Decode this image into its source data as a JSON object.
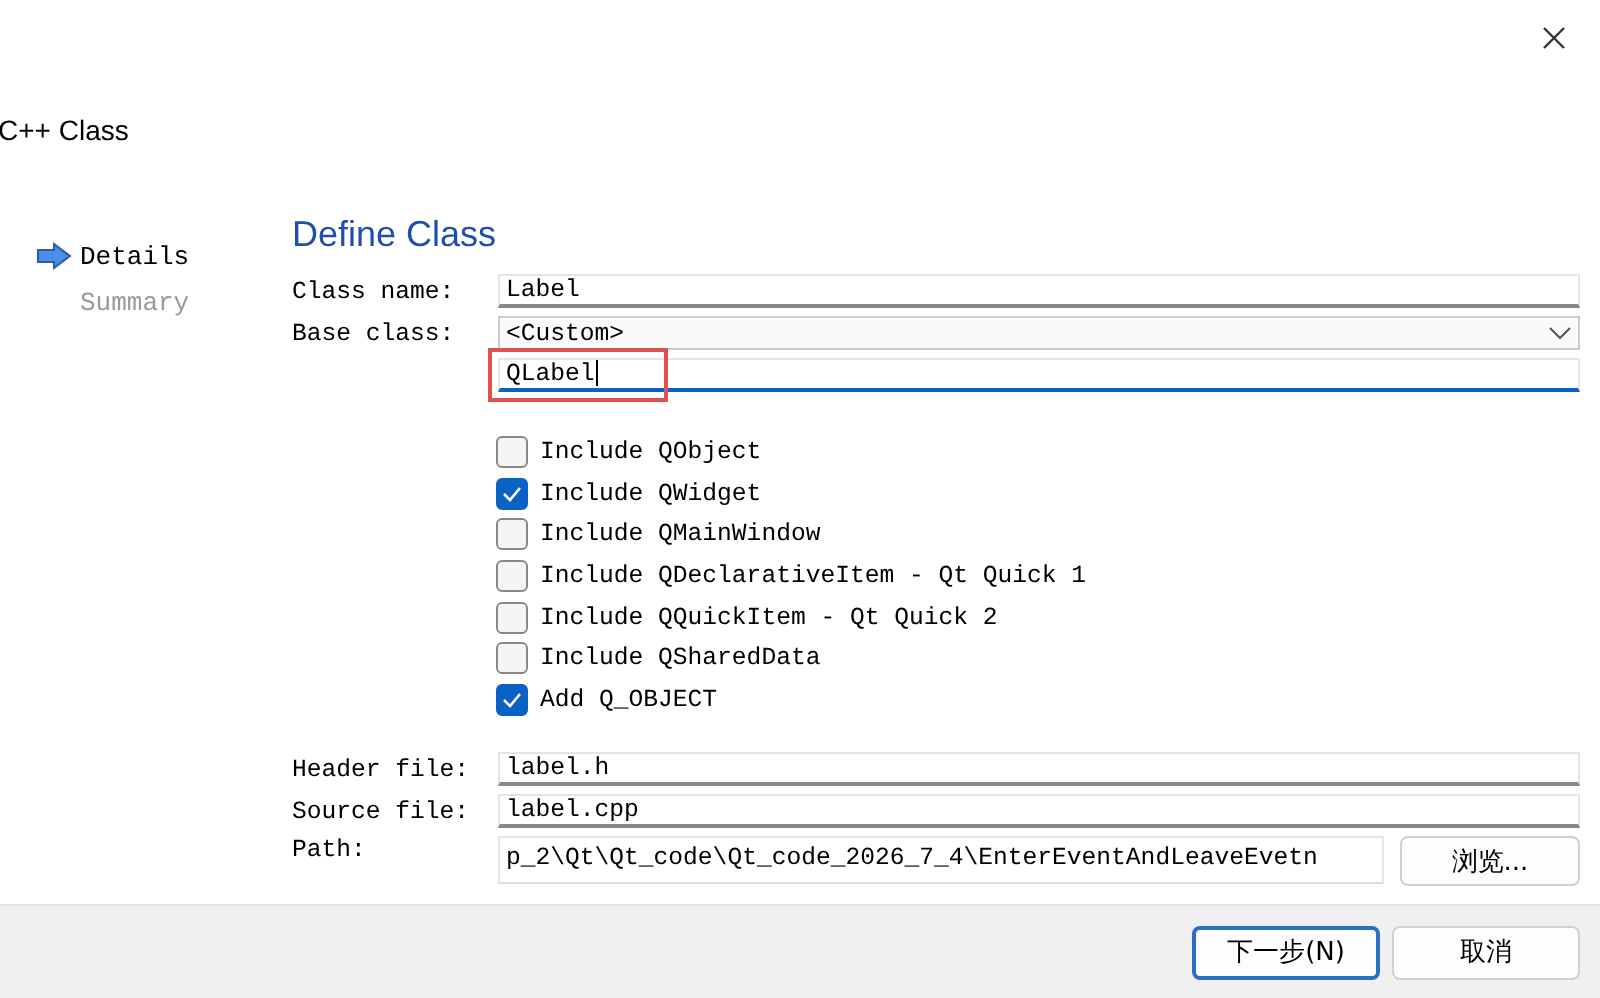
{
  "window": {
    "title": "C++ Class"
  },
  "sidebar": {
    "items": [
      {
        "label": "Details",
        "selected": true
      },
      {
        "label": "Summary",
        "selected": false
      }
    ]
  },
  "page": {
    "heading": "Define Class",
    "class_name": {
      "label": "Class name:",
      "value": "Label"
    },
    "base_class": {
      "label": "Base class:",
      "value": "<Custom>",
      "custom_value": "QLabel"
    },
    "options": [
      {
        "label": "Include QObject",
        "checked": false
      },
      {
        "label": "Include QWidget",
        "checked": true
      },
      {
        "label": "Include QMainWindow",
        "checked": false
      },
      {
        "label": "Include QDeclarativeItem - Qt Quick 1",
        "checked": false
      },
      {
        "label": "Include QQuickItem - Qt Quick 2",
        "checked": false
      },
      {
        "label": "Include QSharedData",
        "checked": false
      },
      {
        "label": "Add Q_OBJECT",
        "checked": true
      }
    ],
    "header_file": {
      "label": "Header file:",
      "value": "label.h"
    },
    "source_file": {
      "label": "Source file:",
      "value": "label.cpp"
    },
    "path": {
      "label": "Path:",
      "value": "p_2\\Qt\\Qt_code\\Qt_code_2026_7_4\\EnterEventAndLeaveEvetn",
      "browse": "浏览..."
    }
  },
  "buttons": [
    {
      "label": "下一步(N)",
      "default": true
    },
    {
      "label": "取消",
      "default": false
    }
  ]
}
